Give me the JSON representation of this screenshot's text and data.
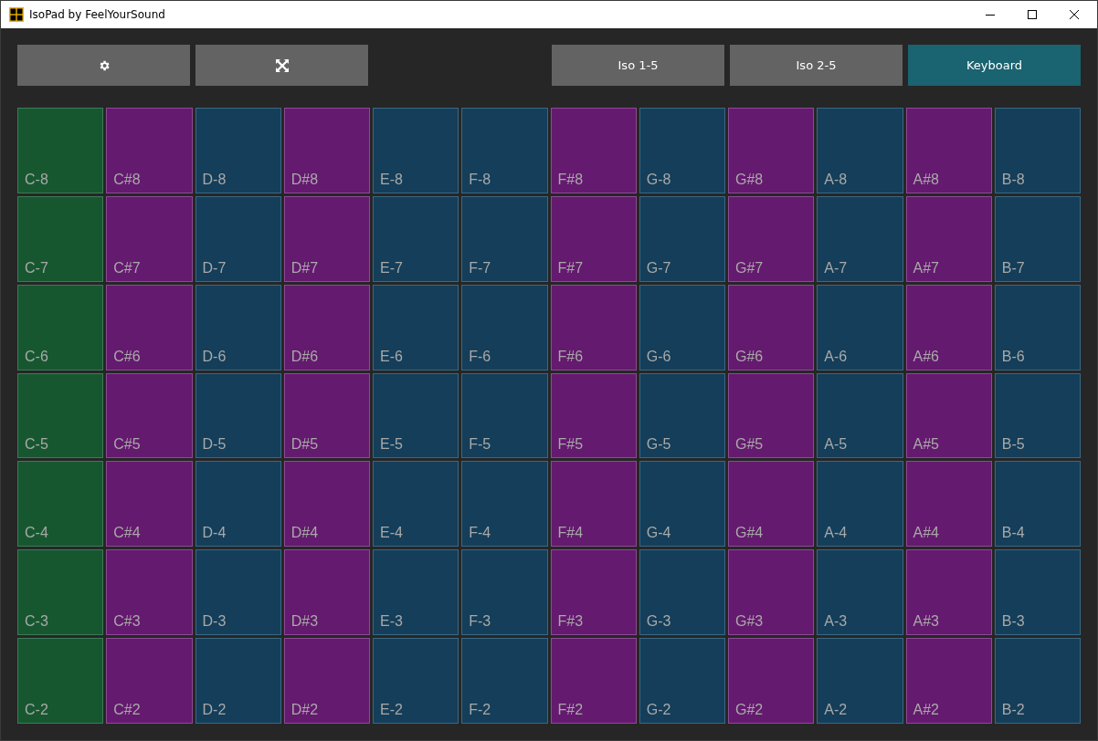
{
  "window": {
    "title": "IsoPad by FeelYourSound"
  },
  "toolbar": {
    "tools": [
      {
        "kind": "settings"
      },
      {
        "kind": "fullscreen"
      }
    ],
    "layouts": [
      {
        "label": "Iso 1-5",
        "selected": false
      },
      {
        "label": "Iso 2-5",
        "selected": false
      },
      {
        "label": "Keyboard",
        "selected": true
      }
    ]
  },
  "pads": [
    [
      {
        "label": "C-8",
        "kind": "root"
      },
      {
        "label": "C#8",
        "kind": "sharp"
      },
      {
        "label": "D-8",
        "kind": "natural"
      },
      {
        "label": "D#8",
        "kind": "sharp"
      },
      {
        "label": "E-8",
        "kind": "natural"
      },
      {
        "label": "F-8",
        "kind": "natural"
      },
      {
        "label": "F#8",
        "kind": "sharp"
      },
      {
        "label": "G-8",
        "kind": "natural"
      },
      {
        "label": "G#8",
        "kind": "sharp"
      },
      {
        "label": "A-8",
        "kind": "natural"
      },
      {
        "label": "A#8",
        "kind": "sharp"
      },
      {
        "label": "B-8",
        "kind": "natural"
      }
    ],
    [
      {
        "label": "C-7",
        "kind": "root"
      },
      {
        "label": "C#7",
        "kind": "sharp"
      },
      {
        "label": "D-7",
        "kind": "natural"
      },
      {
        "label": "D#7",
        "kind": "sharp"
      },
      {
        "label": "E-7",
        "kind": "natural"
      },
      {
        "label": "F-7",
        "kind": "natural"
      },
      {
        "label": "F#7",
        "kind": "sharp"
      },
      {
        "label": "G-7",
        "kind": "natural"
      },
      {
        "label": "G#7",
        "kind": "sharp"
      },
      {
        "label": "A-7",
        "kind": "natural"
      },
      {
        "label": "A#7",
        "kind": "sharp"
      },
      {
        "label": "B-7",
        "kind": "natural"
      }
    ],
    [
      {
        "label": "C-6",
        "kind": "root"
      },
      {
        "label": "C#6",
        "kind": "sharp"
      },
      {
        "label": "D-6",
        "kind": "natural"
      },
      {
        "label": "D#6",
        "kind": "sharp"
      },
      {
        "label": "E-6",
        "kind": "natural"
      },
      {
        "label": "F-6",
        "kind": "natural"
      },
      {
        "label": "F#6",
        "kind": "sharp"
      },
      {
        "label": "G-6",
        "kind": "natural"
      },
      {
        "label": "G#6",
        "kind": "sharp"
      },
      {
        "label": "A-6",
        "kind": "natural"
      },
      {
        "label": "A#6",
        "kind": "sharp"
      },
      {
        "label": "B-6",
        "kind": "natural"
      }
    ],
    [
      {
        "label": "C-5",
        "kind": "root"
      },
      {
        "label": "C#5",
        "kind": "sharp"
      },
      {
        "label": "D-5",
        "kind": "natural"
      },
      {
        "label": "D#5",
        "kind": "sharp"
      },
      {
        "label": "E-5",
        "kind": "natural"
      },
      {
        "label": "F-5",
        "kind": "natural"
      },
      {
        "label": "F#5",
        "kind": "sharp"
      },
      {
        "label": "G-5",
        "kind": "natural"
      },
      {
        "label": "G#5",
        "kind": "sharp"
      },
      {
        "label": "A-5",
        "kind": "natural"
      },
      {
        "label": "A#5",
        "kind": "sharp"
      },
      {
        "label": "B-5",
        "kind": "natural"
      }
    ],
    [
      {
        "label": "C-4",
        "kind": "root"
      },
      {
        "label": "C#4",
        "kind": "sharp"
      },
      {
        "label": "D-4",
        "kind": "natural"
      },
      {
        "label": "D#4",
        "kind": "sharp"
      },
      {
        "label": "E-4",
        "kind": "natural"
      },
      {
        "label": "F-4",
        "kind": "natural"
      },
      {
        "label": "F#4",
        "kind": "sharp"
      },
      {
        "label": "G-4",
        "kind": "natural"
      },
      {
        "label": "G#4",
        "kind": "sharp"
      },
      {
        "label": "A-4",
        "kind": "natural"
      },
      {
        "label": "A#4",
        "kind": "sharp"
      },
      {
        "label": "B-4",
        "kind": "natural"
      }
    ],
    [
      {
        "label": "C-3",
        "kind": "root"
      },
      {
        "label": "C#3",
        "kind": "sharp"
      },
      {
        "label": "D-3",
        "kind": "natural"
      },
      {
        "label": "D#3",
        "kind": "sharp"
      },
      {
        "label": "E-3",
        "kind": "natural"
      },
      {
        "label": "F-3",
        "kind": "natural"
      },
      {
        "label": "F#3",
        "kind": "sharp"
      },
      {
        "label": "G-3",
        "kind": "natural"
      },
      {
        "label": "G#3",
        "kind": "sharp"
      },
      {
        "label": "A-3",
        "kind": "natural"
      },
      {
        "label": "A#3",
        "kind": "sharp"
      },
      {
        "label": "B-3",
        "kind": "natural"
      }
    ],
    [
      {
        "label": "C-2",
        "kind": "root"
      },
      {
        "label": "C#2",
        "kind": "sharp"
      },
      {
        "label": "D-2",
        "kind": "natural"
      },
      {
        "label": "D#2",
        "kind": "sharp"
      },
      {
        "label": "E-2",
        "kind": "natural"
      },
      {
        "label": "F-2",
        "kind": "natural"
      },
      {
        "label": "F#2",
        "kind": "sharp"
      },
      {
        "label": "G-2",
        "kind": "natural"
      },
      {
        "label": "G#2",
        "kind": "sharp"
      },
      {
        "label": "A-2",
        "kind": "natural"
      },
      {
        "label": "A#2",
        "kind": "sharp"
      },
      {
        "label": "B-2",
        "kind": "natural"
      }
    ]
  ]
}
